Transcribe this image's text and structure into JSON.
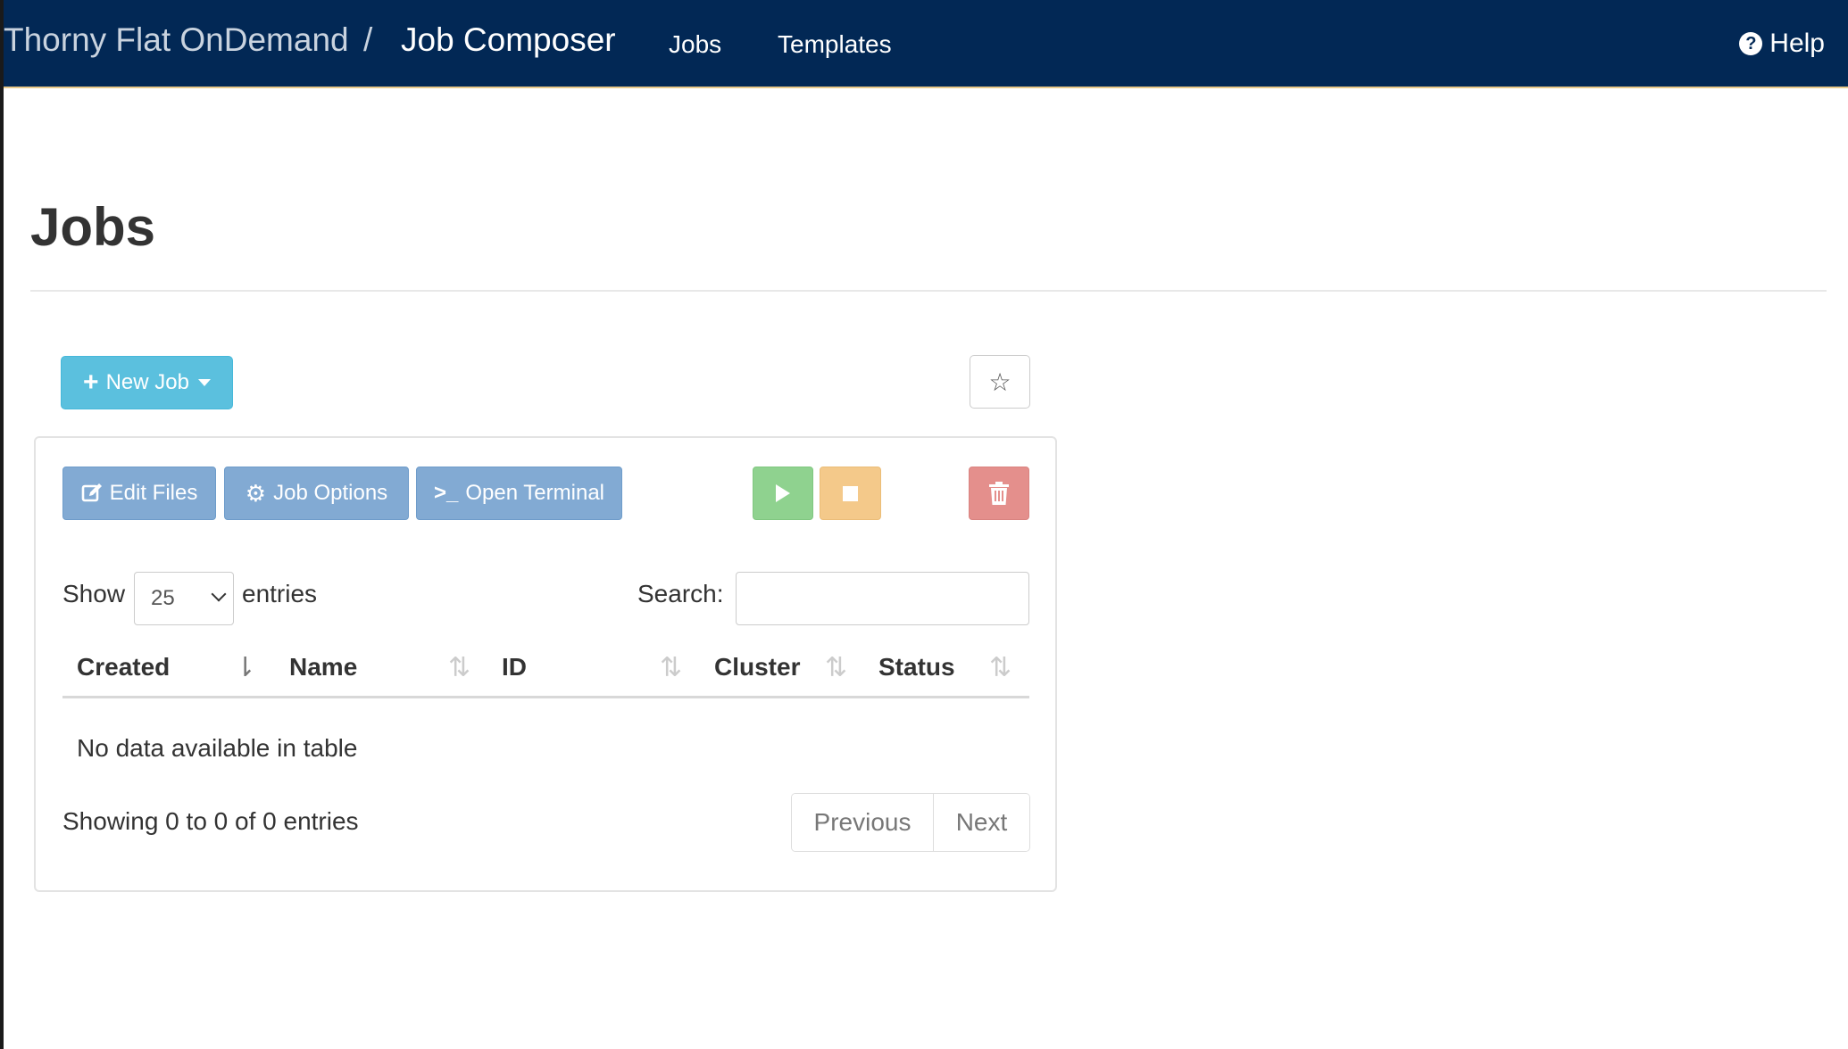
{
  "navbar": {
    "brand": "Thorny Flat OnDemand",
    "separator": "/",
    "app_name": "Job Composer",
    "links": [
      {
        "label": "Jobs"
      },
      {
        "label": "Templates"
      }
    ],
    "help_label": "Help",
    "background_color": "#022855"
  },
  "page": {
    "title": "Jobs"
  },
  "toolbar_top": {
    "new_job_label": "New Job",
    "new_job_icon": "plus-icon",
    "star_icon": "star-outline-icon"
  },
  "job_actions": {
    "edit_files_label": "Edit Files",
    "job_options_label": "Job Options",
    "open_terminal_label": "Open Terminal",
    "submit_icon": "play-icon",
    "stop_icon": "stop-icon",
    "delete_icon": "trash-icon",
    "colors": {
      "info_blue": "#82aad3",
      "success_green": "#8fd28f",
      "warning_orange": "#f4c98a",
      "danger_red": "#e48f8c"
    }
  },
  "table_controls": {
    "show_label": "Show",
    "entries_value": "25",
    "entries_label": "entries",
    "search_label": "Search:",
    "search_value": ""
  },
  "table": {
    "columns": [
      {
        "label": "Created",
        "sort": "descending"
      },
      {
        "label": "Name",
        "sort": "none"
      },
      {
        "label": "ID",
        "sort": "none"
      },
      {
        "label": "Cluster",
        "sort": "none"
      },
      {
        "label": "Status",
        "sort": "none"
      }
    ],
    "empty_message": "No data available in table",
    "info": "Showing 0 to 0 of 0 entries",
    "pagination": {
      "previous_label": "Previous",
      "next_label": "Next"
    }
  }
}
